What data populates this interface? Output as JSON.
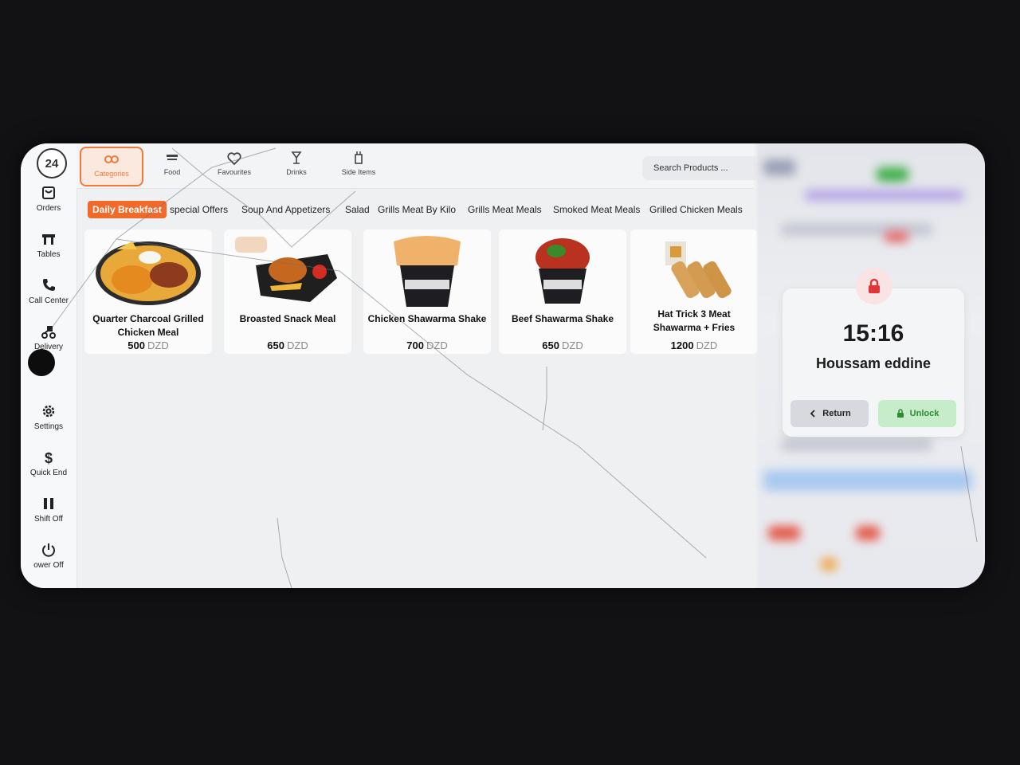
{
  "sidebar": {
    "logo_text": "24",
    "items": [
      {
        "label": "Orders",
        "icon": "orders-icon"
      },
      {
        "label": "Tables",
        "icon": "table-icon"
      },
      {
        "label": "Call Center",
        "icon": "phone-icon"
      },
      {
        "label": "Delivery",
        "icon": "delivery-icon"
      },
      {
        "label": "Settings",
        "icon": "gear-icon"
      },
      {
        "label": "Quick End",
        "icon": "dollar-icon"
      },
      {
        "label": "Shift Off",
        "icon": "pause-icon"
      },
      {
        "label": "ower Off",
        "icon": "power-icon"
      }
    ]
  },
  "categories": [
    {
      "label": "Categories",
      "icon": "categories-icon",
      "active": true
    },
    {
      "label": "Food",
      "icon": "food-icon"
    },
    {
      "label": "Favourites",
      "icon": "heart-icon"
    },
    {
      "label": "Drinks",
      "icon": "drink-icon"
    },
    {
      "label": "Side Items",
      "icon": "side-items-icon"
    }
  ],
  "search": {
    "placeholder": "Search Products ..."
  },
  "subcategories": [
    {
      "label": "Daily Breakfast",
      "active": true
    },
    {
      "label": "special Offers"
    },
    {
      "label": "Soup And Appetizers"
    },
    {
      "label": "Salad"
    },
    {
      "label": "Grills Meat By Kilo"
    },
    {
      "label": "Grills Meat Meals"
    },
    {
      "label": "Smoked Meat Meals"
    },
    {
      "label": "Grilled Chicken Meals"
    }
  ],
  "products": [
    {
      "name": "Quarter Charcoal Grilled Chicken Meal",
      "price": "500",
      "currency": "DZD"
    },
    {
      "name": "Broasted Snack Meal",
      "price": "650",
      "currency": "DZD"
    },
    {
      "name": "Chicken Shawarma Shake",
      "price": "700",
      "currency": "DZD"
    },
    {
      "name": "Beef Shawarma Shake",
      "price": "650",
      "currency": "DZD"
    },
    {
      "name": "Hat Trick 3 Meat Shawarma + Fries",
      "price": "1200",
      "currency": "DZD"
    }
  ],
  "lock": {
    "time": "15:16",
    "user": "Houssam eddine",
    "return_label": "Return",
    "unlock_label": "Unlock"
  },
  "colors": {
    "accent": "#f26a2a",
    "unlock": "#2f8a35",
    "lock": "#e0363a"
  }
}
